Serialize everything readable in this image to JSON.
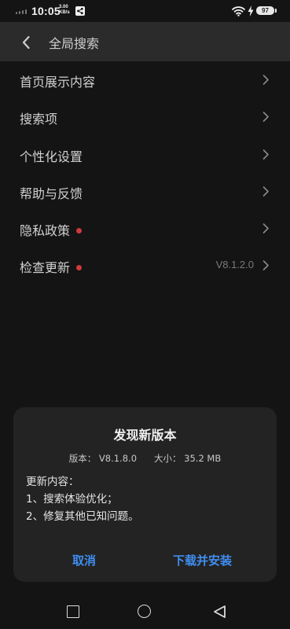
{
  "status_bar": {
    "time": "10:05",
    "net_speed_value": "3.00",
    "net_speed_unit": "KB/s",
    "battery": "97",
    "icons": [
      "signal-icon",
      "share-icon",
      "wifi-icon",
      "charging-icon",
      "battery-icon"
    ]
  },
  "header": {
    "title": "全局搜索",
    "back_icon": "chevron-left-icon"
  },
  "menu": {
    "items": [
      {
        "label": "首页展示内容",
        "value": "",
        "has_dot": false
      },
      {
        "label": "搜索项",
        "value": "",
        "has_dot": false
      },
      {
        "label": "个性化设置",
        "value": "",
        "has_dot": false
      },
      {
        "label": "帮助与反馈",
        "value": "",
        "has_dot": false
      },
      {
        "label": "隐私政策",
        "value": "",
        "has_dot": true
      },
      {
        "label": "检查更新",
        "value": "V8.1.2.0",
        "has_dot": true
      }
    ]
  },
  "dialog": {
    "title": "发现新版本",
    "version_text": "版本： V8.1.8.0",
    "size_text": "大小： 35.2 MB",
    "notes_heading": "更新内容：",
    "notes": [
      "1、搜索体验优化；",
      "2、修复其他已知问题。"
    ],
    "cancel_label": "取消",
    "install_label": "下载并安装"
  },
  "colors": {
    "background": "#141414",
    "header": "#2b2b2b",
    "dialog": "#232323",
    "accent": "#3f8ef0",
    "badge_dot": "#cf3a3e"
  },
  "nav_bar": {
    "icons": [
      "recent-apps-icon",
      "home-icon",
      "back-icon"
    ]
  }
}
